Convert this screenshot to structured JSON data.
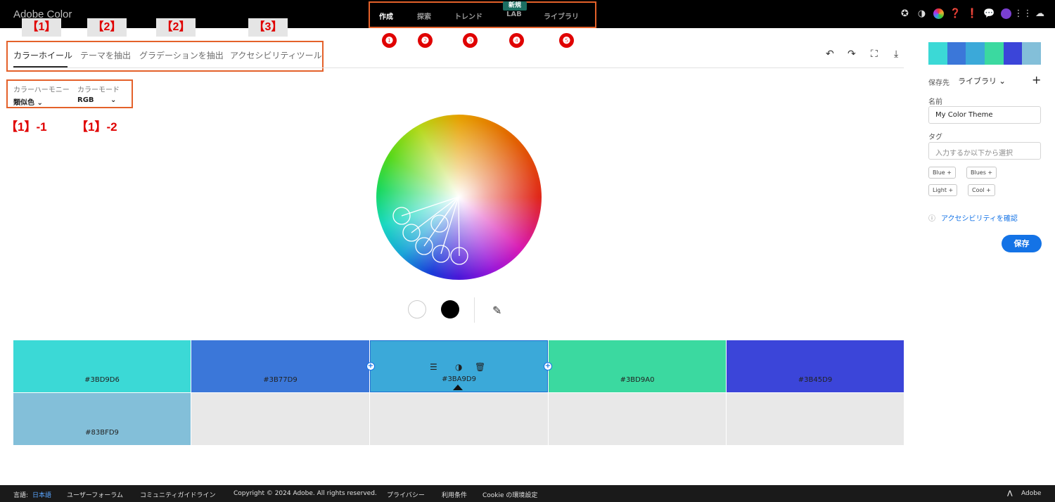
{
  "app": {
    "title": "Adobe Color"
  },
  "nav": {
    "items": [
      {
        "label": "作成"
      },
      {
        "label": "探索"
      },
      {
        "label": "トレンド"
      },
      {
        "label": "LAB"
      },
      {
        "label": "ライブラリ"
      }
    ],
    "new_badge": "新規"
  },
  "annotations": {
    "circled": [
      "❶",
      "❷",
      "❸",
      "❹",
      "❺"
    ],
    "brackets": [
      "【1】",
      "【2】",
      "【2】",
      "【3】"
    ],
    "harmony_notes": [
      "【1】-1",
      "【1】-2"
    ],
    "annotation_color": "#e00000",
    "box_color": "#e4612a"
  },
  "tabs": [
    {
      "label": "カラーホイール"
    },
    {
      "label": "テーマを抽出"
    },
    {
      "label": "グラデーションを抽出"
    },
    {
      "label": "アクセシビリティツール"
    }
  ],
  "harmony": {
    "label": "カラーハーモニー",
    "value": "類似色",
    "mode_label": "カラーモード",
    "mode_value": "RGB"
  },
  "swatches": [
    {
      "hex": "#3BD9D6",
      "color": "#3BD9D6"
    },
    {
      "hex": "#3B77D9",
      "color": "#3B77D9"
    },
    {
      "hex": "#3BA9D9",
      "color": "#3BA9D9"
    },
    {
      "hex": "#3BD9A0",
      "color": "#3BD9A0"
    },
    {
      "hex": "#3B45D9",
      "color": "#3B45D9"
    },
    {
      "hex": "#83BFD9",
      "color": "#83BFD9"
    }
  ],
  "right_panel": {
    "save_to_label": "保存先",
    "save_to_value": "ライブラリ",
    "name_label": "名前",
    "name_value": "My Color Theme",
    "tag_label": "タグ",
    "tag_placeholder": "入力するか以下から選択",
    "tags": [
      "Blue +",
      "Blues +",
      "Light +",
      "Cool +"
    ],
    "a11y_link": "アクセシビリティを確認",
    "save_button": "保存"
  },
  "footer": {
    "lang_label": "言語:",
    "lang_value": "日本語",
    "links": [
      "ユーザーフォーラム",
      "コミュニティガイドライン",
      "Copyright © 2024 Adobe. All rights reserved.",
      "プライバシー",
      "利用条件",
      "Cookie の環境設定"
    ],
    "brand": "Adobe"
  }
}
